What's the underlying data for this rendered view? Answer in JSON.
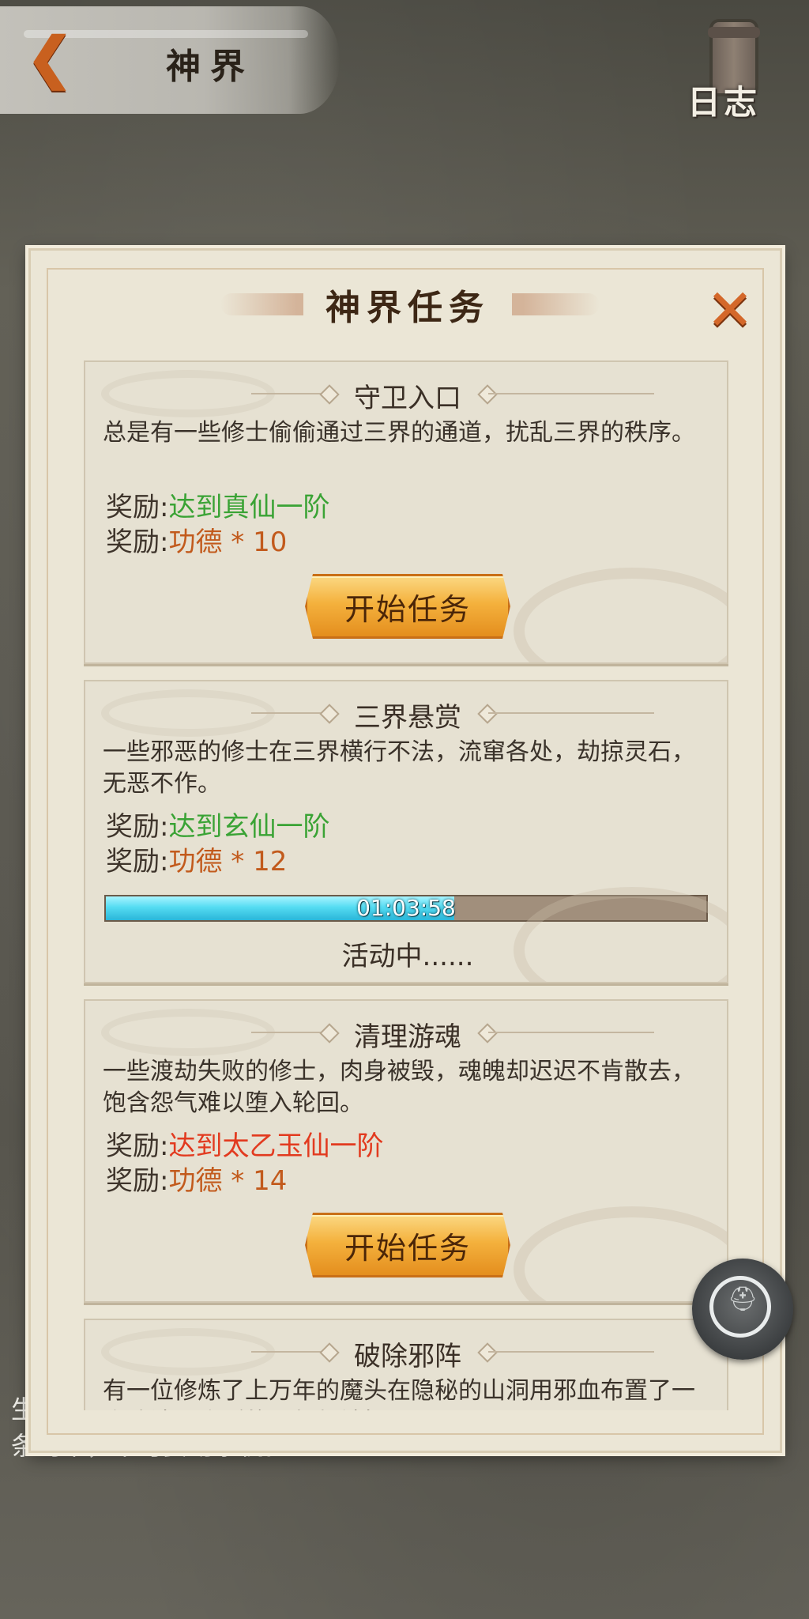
{
  "header": {
    "title": "神界",
    "back_icon": "chevron-left-icon",
    "log_label": "日志",
    "log_icon": "scroll-icon"
  },
  "background_text": {
    "line1": "生",
    "line2": "条约束，不可妄动杀机。"
  },
  "panel": {
    "title": "神界任务",
    "close_icon": "close-icon"
  },
  "tasks": [
    {
      "title": "守卫入口",
      "description": "总是有一些修士偷偷通过三界的通道，扰乱三界的秩序。",
      "reward1_label": "奖励:",
      "reward1_value": "达到真仙一阶",
      "reward1_color": "#3aa335",
      "reward2_label": "奖励:",
      "reward2_value": "功德 * 10",
      "reward2_color": "#c25a1c",
      "button_label": "开始任务"
    },
    {
      "title": "三界悬赏",
      "description": "一些邪恶的修士在三界横行不法，流窜各处，劫掠灵石，无恶不作。",
      "reward1_label": "奖励:",
      "reward1_value": "达到玄仙一阶",
      "reward1_color": "#3aa335",
      "reward2_label": "奖励:",
      "reward2_value": "功德 * 12",
      "reward2_color": "#c25a1c",
      "progress_fraction": 0.58,
      "progress_time": "01:03:58",
      "status": "活动中......"
    },
    {
      "title": "清理游魂",
      "description": "一些渡劫失败的修士，肉身被毁，魂魄却迟迟不肯散去，饱含怨气难以堕入轮回。",
      "reward1_label": "奖励:",
      "reward1_value": "达到太乙玉仙一阶",
      "reward1_color": "#e23a1f",
      "reward2_label": "奖励:",
      "reward2_value": "功德 * 14",
      "reward2_color": "#c25a1c",
      "button_label": "开始任务"
    },
    {
      "title": "破除邪阵",
      "description": "有一位修炼了上万年的魔头在隐秘的山洞用邪血布置了一个阵法，附近的灵气都被损了"
    }
  ],
  "float_button": {
    "icon": "helmet-icon",
    "glyph": "⛑"
  },
  "colors": {
    "accent_orange": "#d4682a",
    "button_gold": "#f4b13d",
    "progress_cyan": "#55dcf2"
  }
}
